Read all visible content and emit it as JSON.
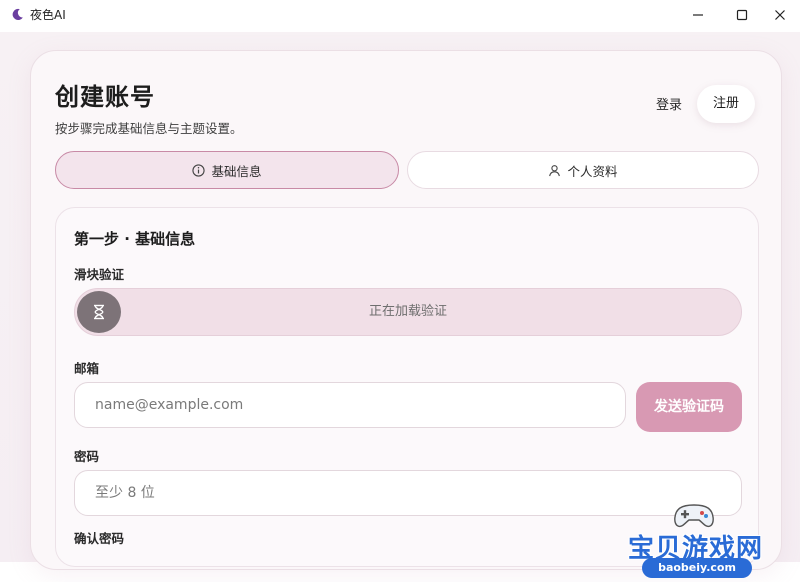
{
  "window": {
    "title": "夜色AI",
    "controls": [
      "minimize-icon",
      "maximize-icon",
      "close-icon"
    ]
  },
  "header": {
    "title": "创建账号",
    "subtitle": "按步骤完成基础信息与主题设置。",
    "login_label": "登录",
    "register_label": "注册"
  },
  "tabs": [
    {
      "label": "基础信息",
      "icon": "info-icon",
      "active": true
    },
    {
      "label": "个人资料",
      "icon": "user-icon",
      "active": false
    }
  ],
  "section": {
    "title": "第一步 · 基础信息",
    "slider": {
      "label": "滑块验证",
      "status_text": "正在加载验证",
      "icon": "hourglass-icon"
    },
    "email": {
      "label": "邮箱",
      "placeholder": "name@example.com",
      "send_code_label": "发送验证码"
    },
    "password": {
      "label": "密码",
      "placeholder": "至少 8 位"
    },
    "confirm_password": {
      "label": "确认密码"
    }
  },
  "watermark": {
    "text": "宝贝游戏网",
    "url": "baobeiy.com"
  },
  "colors": {
    "accent": "#d899b3",
    "tab_active_border": "#c88aa6",
    "background": "#f7f1f4"
  }
}
